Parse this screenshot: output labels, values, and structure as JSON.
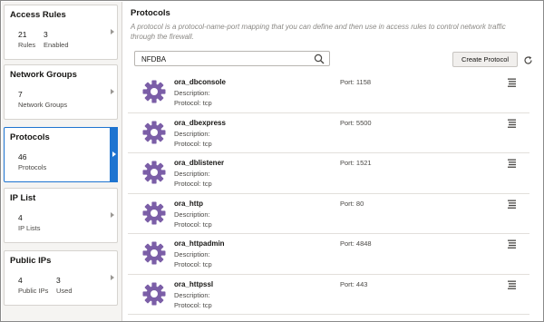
{
  "sidebar": {
    "cards": [
      {
        "title": "Access Rules",
        "stats": [
          {
            "value": "21",
            "label": "Rules"
          },
          {
            "value": "3",
            "label": "Enabled"
          }
        ]
      },
      {
        "title": "Network Groups",
        "stats": [
          {
            "value": "7",
            "label": "Network Groups"
          }
        ]
      },
      {
        "title": "Protocols",
        "stats": [
          {
            "value": "46",
            "label": "Protocols"
          }
        ]
      },
      {
        "title": "IP List",
        "stats": [
          {
            "value": "4",
            "label": "IP Lists"
          }
        ]
      },
      {
        "title": "Public IPs",
        "stats": [
          {
            "value": "4",
            "label": "Public IPs"
          },
          {
            "value": "3",
            "label": "Used"
          }
        ]
      }
    ]
  },
  "main": {
    "title": "Protocols",
    "description": "A protocol is a protocol-name-port mapping that you can define and then use in access rules to control network traffic through the firewall.",
    "search": {
      "value": "NFDBA"
    },
    "create_button": "Create Protocol",
    "protocols": [
      {
        "name": "ora_dbconsole",
        "description": "Description:",
        "protocol": "Protocol: tcp",
        "port": "Port: 1158"
      },
      {
        "name": "ora_dbexpress",
        "description": "Description:",
        "protocol": "Protocol: tcp",
        "port": "Port: 5500"
      },
      {
        "name": "ora_dblistener",
        "description": "Description:",
        "protocol": "Protocol: tcp",
        "port": "Port: 1521"
      },
      {
        "name": "ora_http",
        "description": "Description:",
        "protocol": "Protocol: tcp",
        "port": "Port: 80"
      },
      {
        "name": "ora_httpadmin",
        "description": "Description:",
        "protocol": "Protocol: tcp",
        "port": "Port: 4848"
      },
      {
        "name": "ora_httpssl",
        "description": "Description:",
        "protocol": "Protocol: tcp",
        "port": "Port: 443"
      }
    ]
  },
  "icons": {
    "gear": "gear-icon",
    "search": "search-icon",
    "refresh": "refresh-icon",
    "menu": "hamburger-menu-icon",
    "chevron": "chevron-right-icon"
  },
  "colors": {
    "gear": "#7b5ea7",
    "selected": "#1e74d0",
    "sidebar_bg": "#f5f4f2"
  }
}
